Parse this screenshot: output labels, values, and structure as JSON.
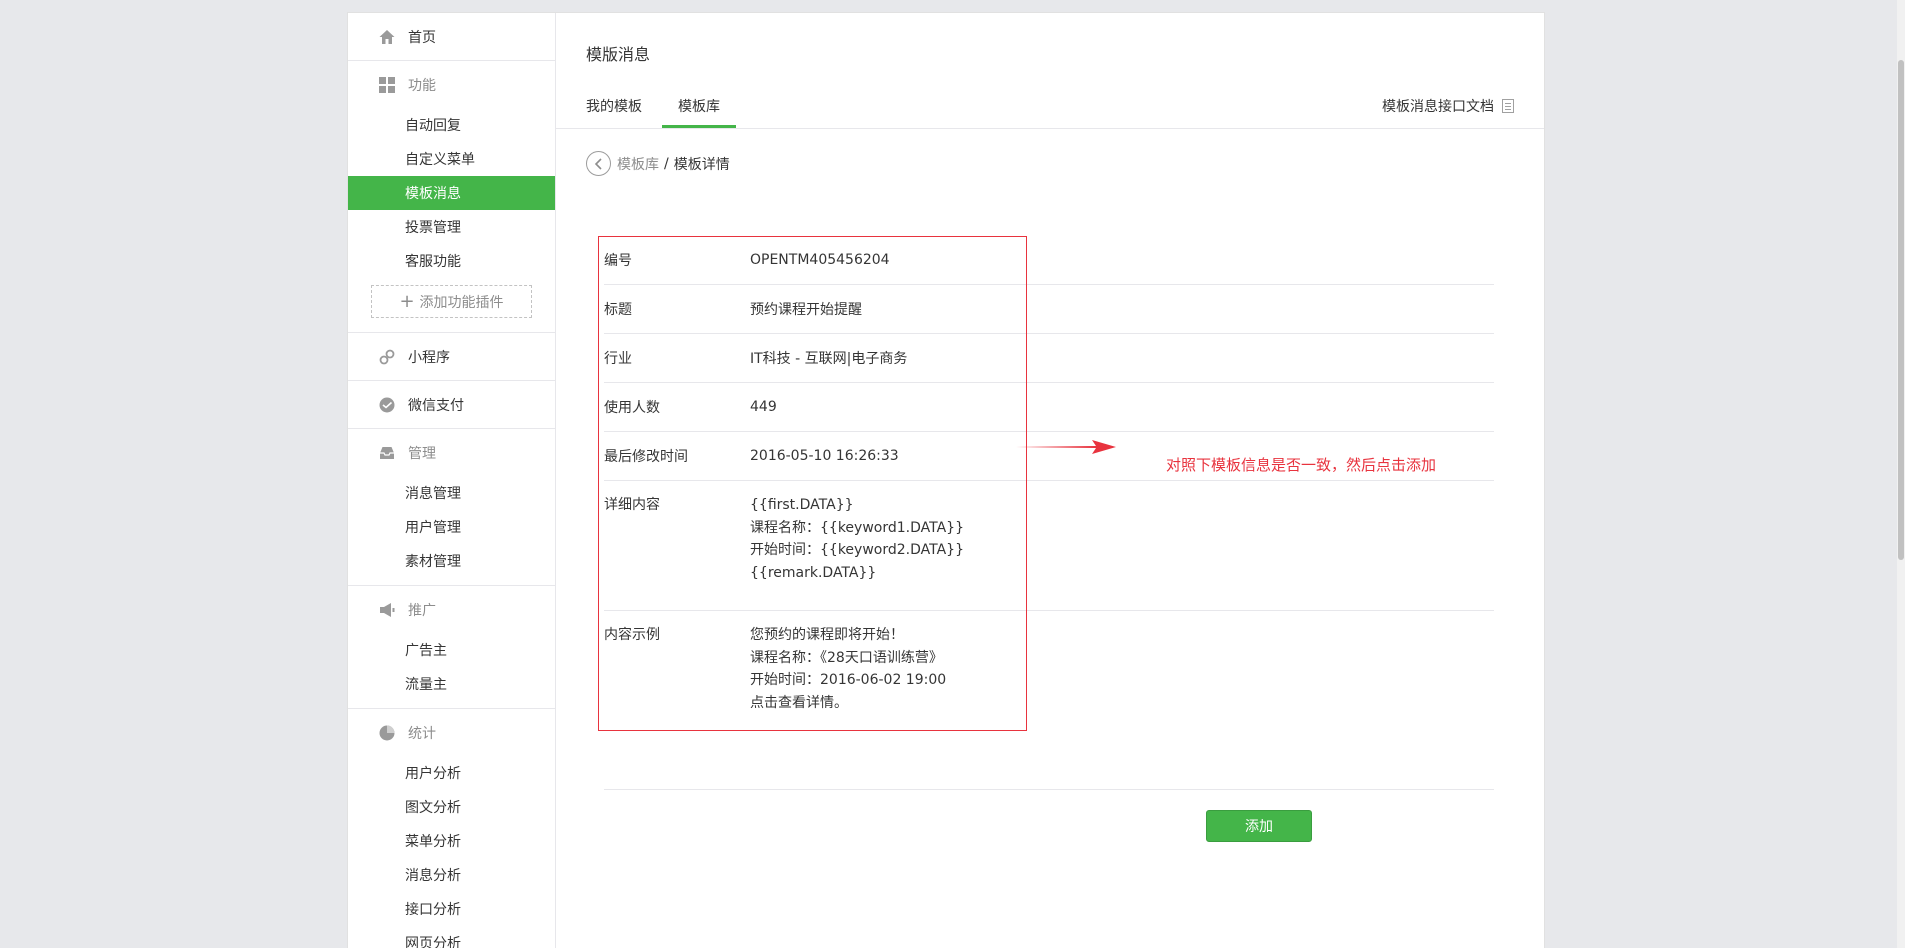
{
  "sidebar": {
    "home": "首页",
    "function": {
      "header": "功能",
      "items": [
        "自动回复",
        "自定义菜单",
        "模板消息",
        "投票管理",
        "客服功能"
      ],
      "active_index": 2,
      "add_plugin": "添加功能插件"
    },
    "miniprogram": "小程序",
    "wechatpay": "微信支付",
    "manage": {
      "header": "管理",
      "items": [
        "消息管理",
        "用户管理",
        "素材管理"
      ]
    },
    "promote": {
      "header": "推广",
      "items": [
        "广告主",
        "流量主"
      ]
    },
    "stats": {
      "header": "统计",
      "items": [
        "用户分析",
        "图文分析",
        "菜单分析",
        "消息分析",
        "接口分析",
        "网页分析"
      ]
    }
  },
  "main": {
    "title": "模版消息",
    "tabs": [
      {
        "label": "我的模板",
        "active": false
      },
      {
        "label": "模板库",
        "active": true
      }
    ],
    "doc_link": "模板消息接口文档",
    "breadcrumb": {
      "library": "模板库",
      "separator": "/",
      "current": "模板详情"
    },
    "detail": {
      "id_label": "编号",
      "id_value": "OPENTM405456204",
      "title_label": "标题",
      "title_value": "预约课程开始提醒",
      "industry_label": "行业",
      "industry_value": "IT科技 - 互联网|电子商务",
      "users_label": "使用人数",
      "users_value": "449",
      "modified_label": "最后修改时间",
      "modified_value": "2016-05-10 16:26:33",
      "content_label": "详细内容",
      "content_lines": [
        "{{first.DATA}}",
        "课程名称：{{keyword1.DATA}}",
        "开始时间：{{keyword2.DATA}}",
        "{{remark.DATA}}"
      ],
      "example_label": "内容示例",
      "example_lines": [
        "您预约的课程即将开始！",
        "课程名称：《28天口语训练营》",
        "开始时间：2016-06-02 19:00",
        "点击查看详情。"
      ]
    },
    "add_button": "添加"
  },
  "annotation": {
    "text": "对照下模板信息是否一致，然后点击添加",
    "color": "#e8333e"
  },
  "colors": {
    "accent": "#44b549",
    "annotation_red": "#e8333e"
  }
}
